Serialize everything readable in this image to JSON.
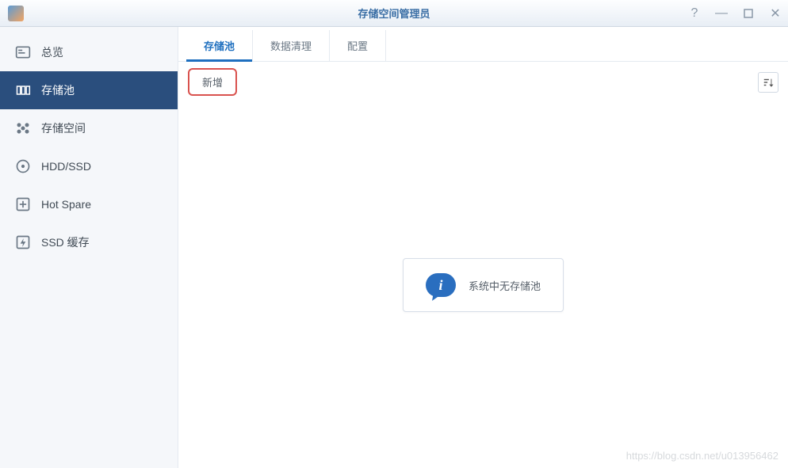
{
  "window": {
    "title": "存储空间管理员"
  },
  "sidebar": {
    "items": [
      {
        "label": "总览",
        "icon": "overview"
      },
      {
        "label": "存储池",
        "icon": "pool",
        "active": true
      },
      {
        "label": "存储空间",
        "icon": "volume"
      },
      {
        "label": "HDD/SSD",
        "icon": "disk"
      },
      {
        "label": "Hot Spare",
        "icon": "hotspare"
      },
      {
        "label": "SSD 缓存",
        "icon": "ssdcache"
      }
    ]
  },
  "tabs": {
    "items": [
      {
        "label": "存储池",
        "active": true
      },
      {
        "label": "数据清理"
      },
      {
        "label": "配置"
      }
    ]
  },
  "toolbar": {
    "new_label": "新增"
  },
  "empty_state": {
    "message": "系统中无存储池"
  },
  "watermark": "https://blog.csdn.net/u013956462"
}
